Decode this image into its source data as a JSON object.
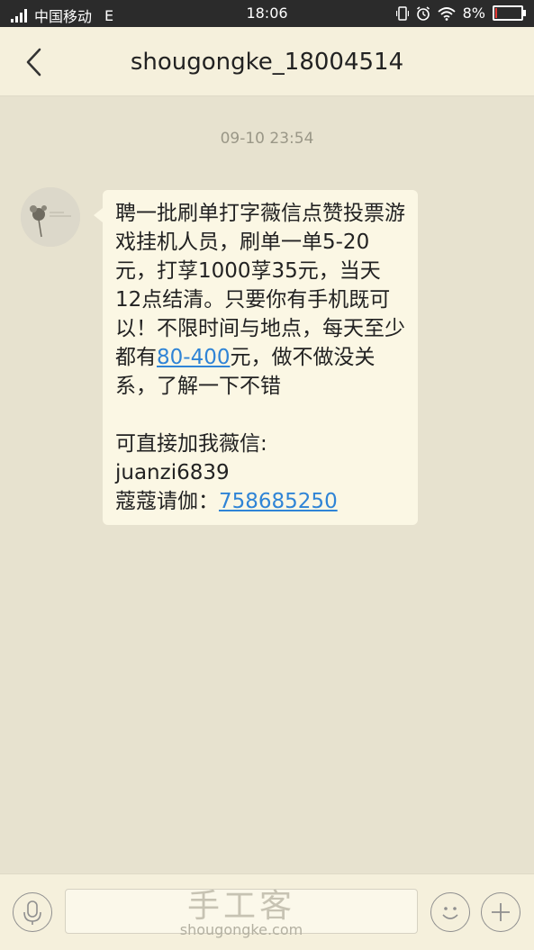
{
  "status_bar": {
    "carrier": "中国移动",
    "network": "E",
    "time": "18:06",
    "battery_text": "8%",
    "battery_level": 0.08,
    "battery_color": "#e53935"
  },
  "header": {
    "title": "shougongke_18004514",
    "back_icon": "chevron-left-icon"
  },
  "conversation": {
    "timestamp": "09-10 23:54",
    "message": {
      "part1": "聘一批刷单打字薇信点赞投票游戏挂机人员，刷单一单5-20元，打莩1000莩35元，当天12点结清。只要你有手机既可以！不限时间与地点，每天至少都有",
      "link1": "80-400",
      "part2": "元，做不做没关系，了解一下不错",
      "line_wechat_label": "可直接加我薇信:",
      "wechat_id": "juanzi6839",
      "qq_label": "蔻蔻请伽：",
      "qq_link": "758685250"
    }
  },
  "input_bar": {
    "watermark_cn": "手工客",
    "watermark_url": "shougongke.com",
    "mic_icon": "microphone-icon",
    "emoji_icon": "smiley-icon",
    "plus_icon": "plus-icon"
  },
  "colors": {
    "background": "#e7e2cf",
    "header_bg": "#f5f0dc",
    "bubble_bg": "#fbf7e4",
    "link": "#2f84d6"
  }
}
